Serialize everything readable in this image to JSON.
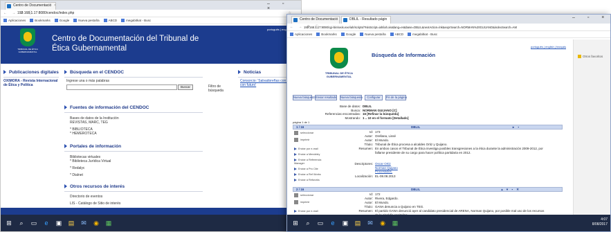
{
  "window1": {
    "tab_title": "Centro de Documentació",
    "url": "192.168.1.17:8080/cendoc/index.php",
    "bookmarks": [
      "Aplicaciones",
      "Bookmarks",
      "Google",
      "Nueva pestaña",
      "ABCD",
      "megabitkat - Busc"
    ],
    "header_title_line1": "Centro de Documentación del Tribunal de",
    "header_title_line2": "Ética Gubernamental",
    "header_lang": "português | english | françai",
    "logo_text": "TRIBUNAL DE ÉTICA GUBERNAMENTAL",
    "left_section": "Publicaciones digitales",
    "left_item": "OXIMORA - Revista Internacional de Ética y Política",
    "search_section": "Búsqueda en el CENDOC",
    "search_placeholder": "Ingrese una o más palabras",
    "search_button": "Buscar",
    "filter_label": "Filtro de búsqueda",
    "noticias_section": "Noticias",
    "noticias_item": "Consorcio: 'Salvadoreñas con paño con futuro'",
    "fuentes_section": "Fuentes de información del CENDOC",
    "fuentes_intro": "Bases de datos de la Institución",
    "fuentes_sub": "REVISTAS, MARC, TEG",
    "fuentes_items": [
      "BIBLIOTECA",
      "HEMEROTECA"
    ],
    "portales_section": "Portales de información",
    "portales_intro": "Bibliotecas virtuales",
    "portales_sub": "Biblioteca Jurídica Virtual",
    "portales_items": [
      "Redalyc",
      "Dialnet"
    ],
    "otros_section": "Otros recursos de interés",
    "otros_items": [
      "Directorio de eventos",
      "LIS - Catálogo de Sitio de interés"
    ]
  },
  "window2": {
    "tab1": "Centro de Documentació",
    "tab2": "DBLIL - Resultado págin",
    "url": "192.168.1.17:9090/cgi-bin/wxis.exe/iah/scripts/?IsisScript=iah/iah.xis&lang=es&base=DBLIL&nextAction=lnk&exprSearch=NORMAN%20GUIJANO&indexSearch=AM",
    "bookmarks": [
      "Aplicaciones",
      "Bookmarks",
      "Google",
      "Nueva pestaña",
      "ABCD",
      "megabitkat - Busc"
    ],
    "bookmarks_right": "Otros favoritos",
    "page_title": "Búsqueda de Información",
    "lang_links": "português | english | français",
    "logo_text": "TRIBUNAL DE ÉTICA GUBERNAMENTAL",
    "buttons": [
      "Nueva búsqueda",
      "Enviar resultado",
      "Nueva búsqueda",
      "Configurar",
      "Fin de la página"
    ],
    "db_label": "Base de datos:",
    "db_value": "DBLIL",
    "search_label": "Busca:",
    "search_value": "NORMAN GUIJANO [C]",
    "refs_label": "Referencias encontradas:",
    "refs_value": "16 [Refinar la búsqueda]",
    "shown_label": "Mostrando:",
    "shown_value": "1 .. 10 en el formato [Detallado]",
    "page_label": "página 1 de 1",
    "record1": {
      "num": "1 / 16",
      "db": "DBLIL",
      "id": "173",
      "autor1": "Orellana, Lissé",
      "autor2": "El Mundo.",
      "titulo": "Tribunal de Ética procesa a alcaldes Ortiz y Quijano.",
      "resumen": "En ambos casos el Tribunal de Ética investiga posibles transgresiones a la ética durante la administración 2009-2012, por fallarse presidente de su cargo para hacer política partidaria en 2012.",
      "descriptores": [
        "Oscar Ortiz",
        "Norman Quijano",
        "Procesados."
      ],
      "localizacion": "EL-08.08.2013"
    },
    "record2": {
      "num": "2 / 16",
      "db": "DBLIL",
      "id": "172",
      "autor1": "Rivera, Edgardo.",
      "autor2": "El Mundo.",
      "titulo": "GANA denuncia a Quijano en TEG.",
      "resumen": "El partido GANA denunció ayer al candidato presidencial de ARENA, Norman Quijano, por posible mal uso de los recursos de la alcaldía capitalina."
    },
    "side_actions": [
      "seleccionar",
      "imprimir",
      "Enviar por e-mail",
      "Enviar a Mendeley",
      "Enviar a Referencia Manager",
      "Enviar a Pro Cite",
      "Enviar a Ref Works",
      "Enviar a Refworks"
    ],
    "tray_time": "4:07",
    "tray_date": "8/08/2017"
  },
  "labels": {
    "id": "Id:",
    "autor": "Autor:",
    "titulo": "Título:",
    "resumen": "Resumen:",
    "descriptores": "Descriptores:",
    "localizacion": "Localización:"
  },
  "taskbar_icons": [
    "windows-start-icon",
    "search-icon",
    "task-view-icon",
    "edge-icon",
    "store-icon",
    "explorer-icon",
    "mail-icon",
    "chrome-icon",
    "app-icon"
  ]
}
